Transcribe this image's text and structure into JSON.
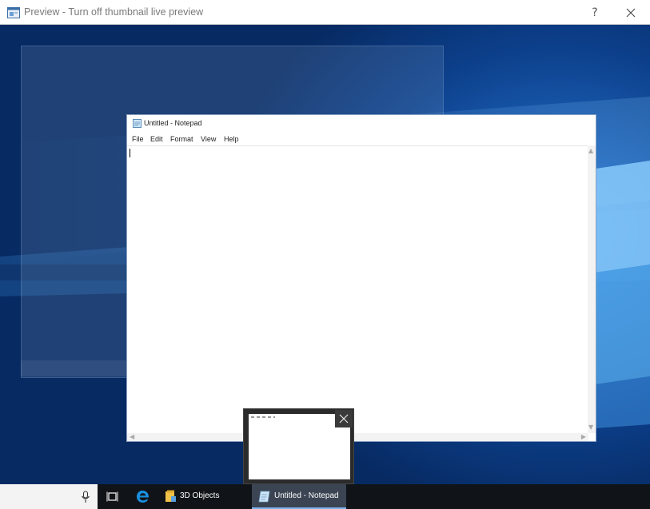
{
  "window": {
    "title": "Preview - Turn off thumbnail live preview",
    "help_label": "?",
    "icons": [
      "preview-app-icon",
      "close-icon"
    ]
  },
  "notepad": {
    "title": "Untitled - Notepad",
    "menu": [
      "File",
      "Edit",
      "Format",
      "View",
      "Help"
    ],
    "content": ""
  },
  "thumbnail": {
    "icons": [
      "close-icon"
    ]
  },
  "taskbar": {
    "buttons": [
      {
        "label": "3D Objects",
        "icon": "folder-icon"
      },
      {
        "label": "Untitled - Notepad",
        "icon": "notepad-icon",
        "active": true
      }
    ],
    "icons": [
      "microphone-icon",
      "task-view-icon",
      "edge-icon"
    ]
  },
  "colors": {
    "desktop": "#1a5cb0",
    "taskbar": "#101418",
    "accent": "#7ab3ec"
  }
}
